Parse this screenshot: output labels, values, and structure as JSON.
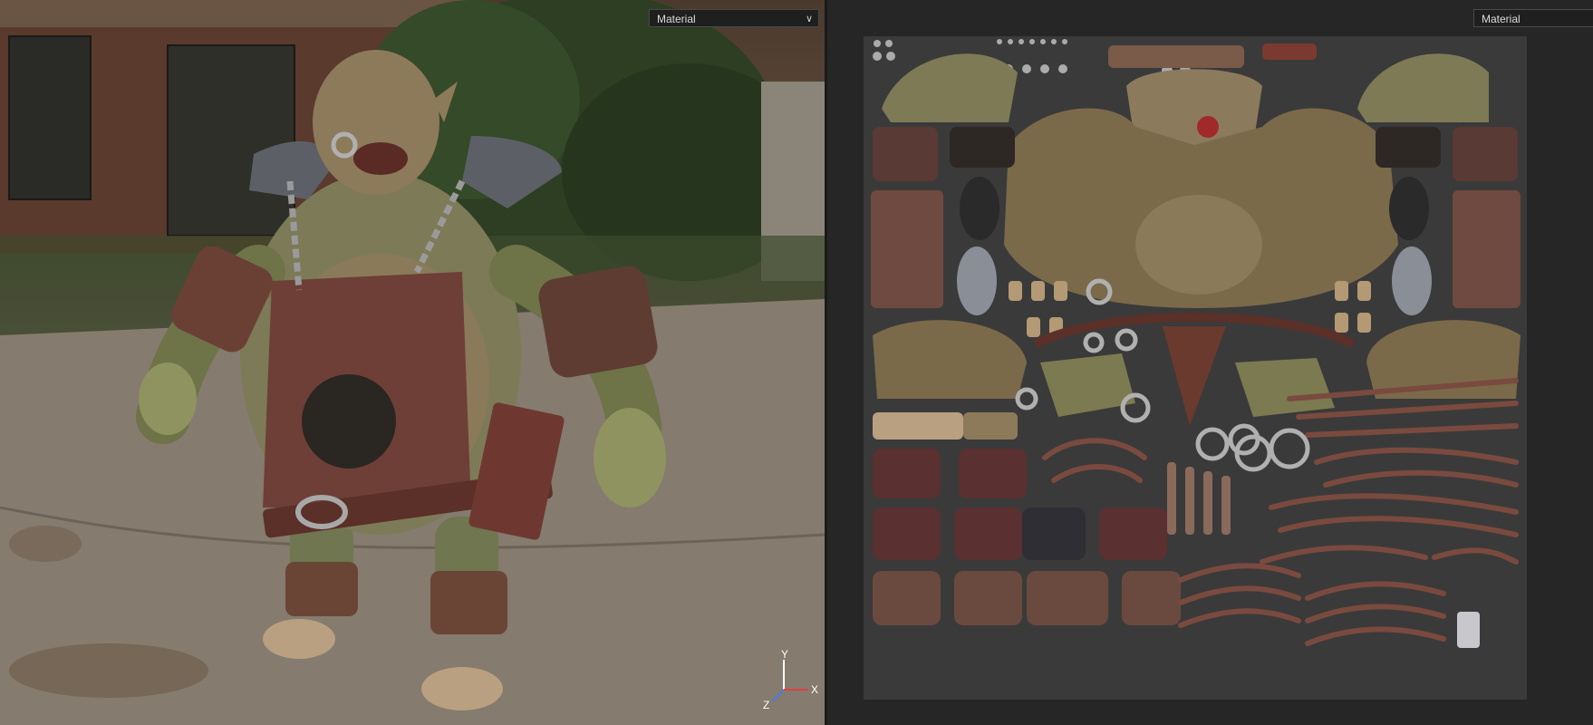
{
  "viewport3d": {
    "material_dropdown": {
      "label": "Material",
      "chevron": "chevron-down-icon"
    },
    "gizmo": {
      "x_label": "X",
      "y_label": "Y",
      "z_label": "Z"
    }
  },
  "viewport2d": {
    "material_dropdown": {
      "label": "Material"
    }
  },
  "colors": {
    "axis_x": "#e04040",
    "axis_y": "#ffffff",
    "axis_z": "#4a7ce0",
    "uv_background": "#3a3a3a",
    "panel_background": "#262626"
  }
}
